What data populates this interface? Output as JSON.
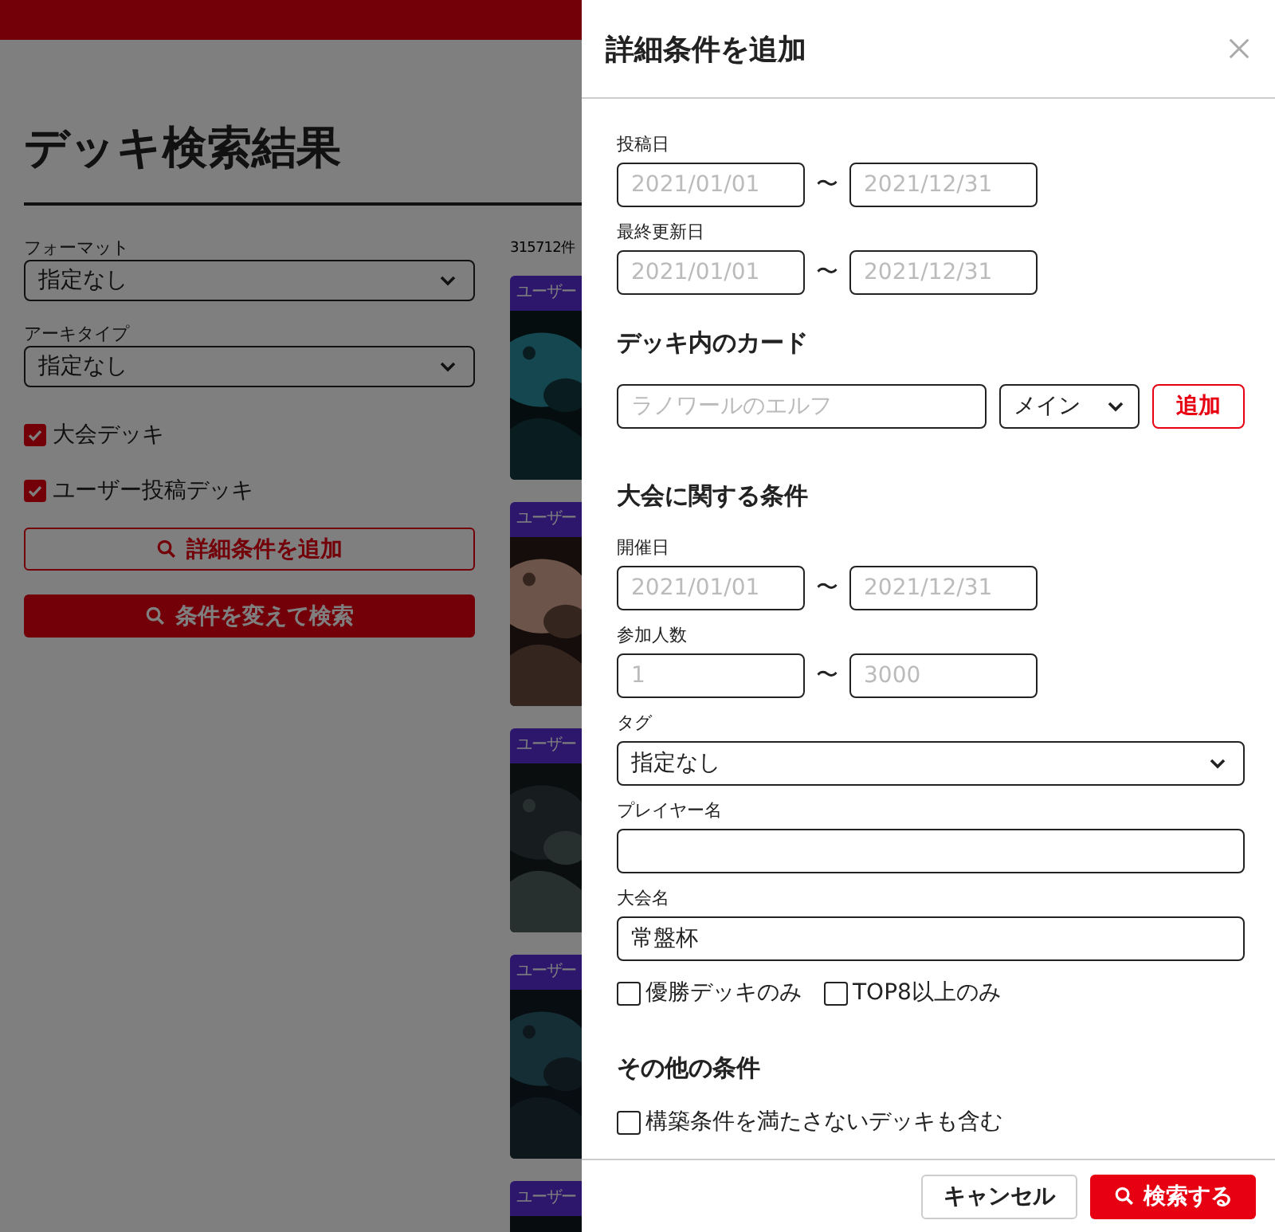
{
  "page": {
    "title": "デッキ検索結果",
    "filters": [
      {
        "label": "フォーマット",
        "value": "指定なし"
      },
      {
        "label": "アーキタイプ",
        "value": "指定なし"
      }
    ],
    "checkboxes": [
      {
        "label": "大会デッキ",
        "checked": true
      },
      {
        "label": "ユーザー投稿デッキ",
        "checked": true
      }
    ],
    "buttons": [
      {
        "label": "詳細条件を追加",
        "kind": "outline"
      },
      {
        "label": "条件を変えて検索",
        "kind": "primary"
      }
    ]
  },
  "results": {
    "count": "315712件",
    "cards": [
      {
        "badge": "ユーザー",
        "kind": "picture"
      },
      {
        "badge": "ユーザー",
        "kind": "picture"
      },
      {
        "badge": "ユーザー",
        "kind": "picture"
      },
      {
        "badge": "ユーザー",
        "kind": "picture"
      },
      {
        "badge": "ユーザー",
        "kind": "picture"
      }
    ]
  },
  "modal": {
    "title": "詳細条件を追加",
    "items": [
      {
        "kind": "range",
        "label": "投稿日",
        "from": {
          "placeholder": "2021/01/01"
        },
        "separator": "〜",
        "to": {
          "placeholder": "2021/12/31"
        }
      },
      {
        "kind": "range",
        "label": "最終更新日",
        "from": {
          "placeholder": "2021/01/01"
        },
        "separator": "〜",
        "to": {
          "placeholder": "2021/12/31"
        }
      },
      {
        "kind": "heading",
        "text": "デッキ内のカード"
      },
      {
        "kind": "card_input",
        "placeholder": "ラノワールのエルフ",
        "select": "メイン",
        "button": "追加"
      },
      {
        "kind": "heading",
        "text": "大会に関する条件"
      },
      {
        "kind": "range",
        "label": "開催日",
        "from": {
          "placeholder": "2021/01/01"
        },
        "separator": "〜",
        "to": {
          "placeholder": "2021/12/31"
        }
      },
      {
        "kind": "range",
        "label": "参加人数",
        "from": {
          "placeholder": "1"
        },
        "separator": "〜",
        "to": {
          "placeholder": "3000"
        }
      },
      {
        "kind": "select",
        "label": "タグ",
        "value": "指定なし"
      },
      {
        "kind": "text",
        "label": "プレイヤー名"
      },
      {
        "kind": "text",
        "label": "大会名",
        "value": "常盤杯"
      },
      {
        "kind": "checks",
        "items": [
          {
            "label": "優勝デッキのみ",
            "checked": false
          },
          {
            "label": "TOP8以上のみ",
            "checked": false
          }
        ]
      },
      {
        "kind": "heading",
        "text": "その他の条件"
      },
      {
        "kind": "checks",
        "items": [
          {
            "label": "構築条件を満たさないデッキも含む",
            "checked": false
          }
        ]
      }
    ],
    "buttons": [
      {
        "label": "キャンセル",
        "kind": "secondary"
      },
      {
        "label": "検索する",
        "kind": "primary"
      }
    ]
  }
}
